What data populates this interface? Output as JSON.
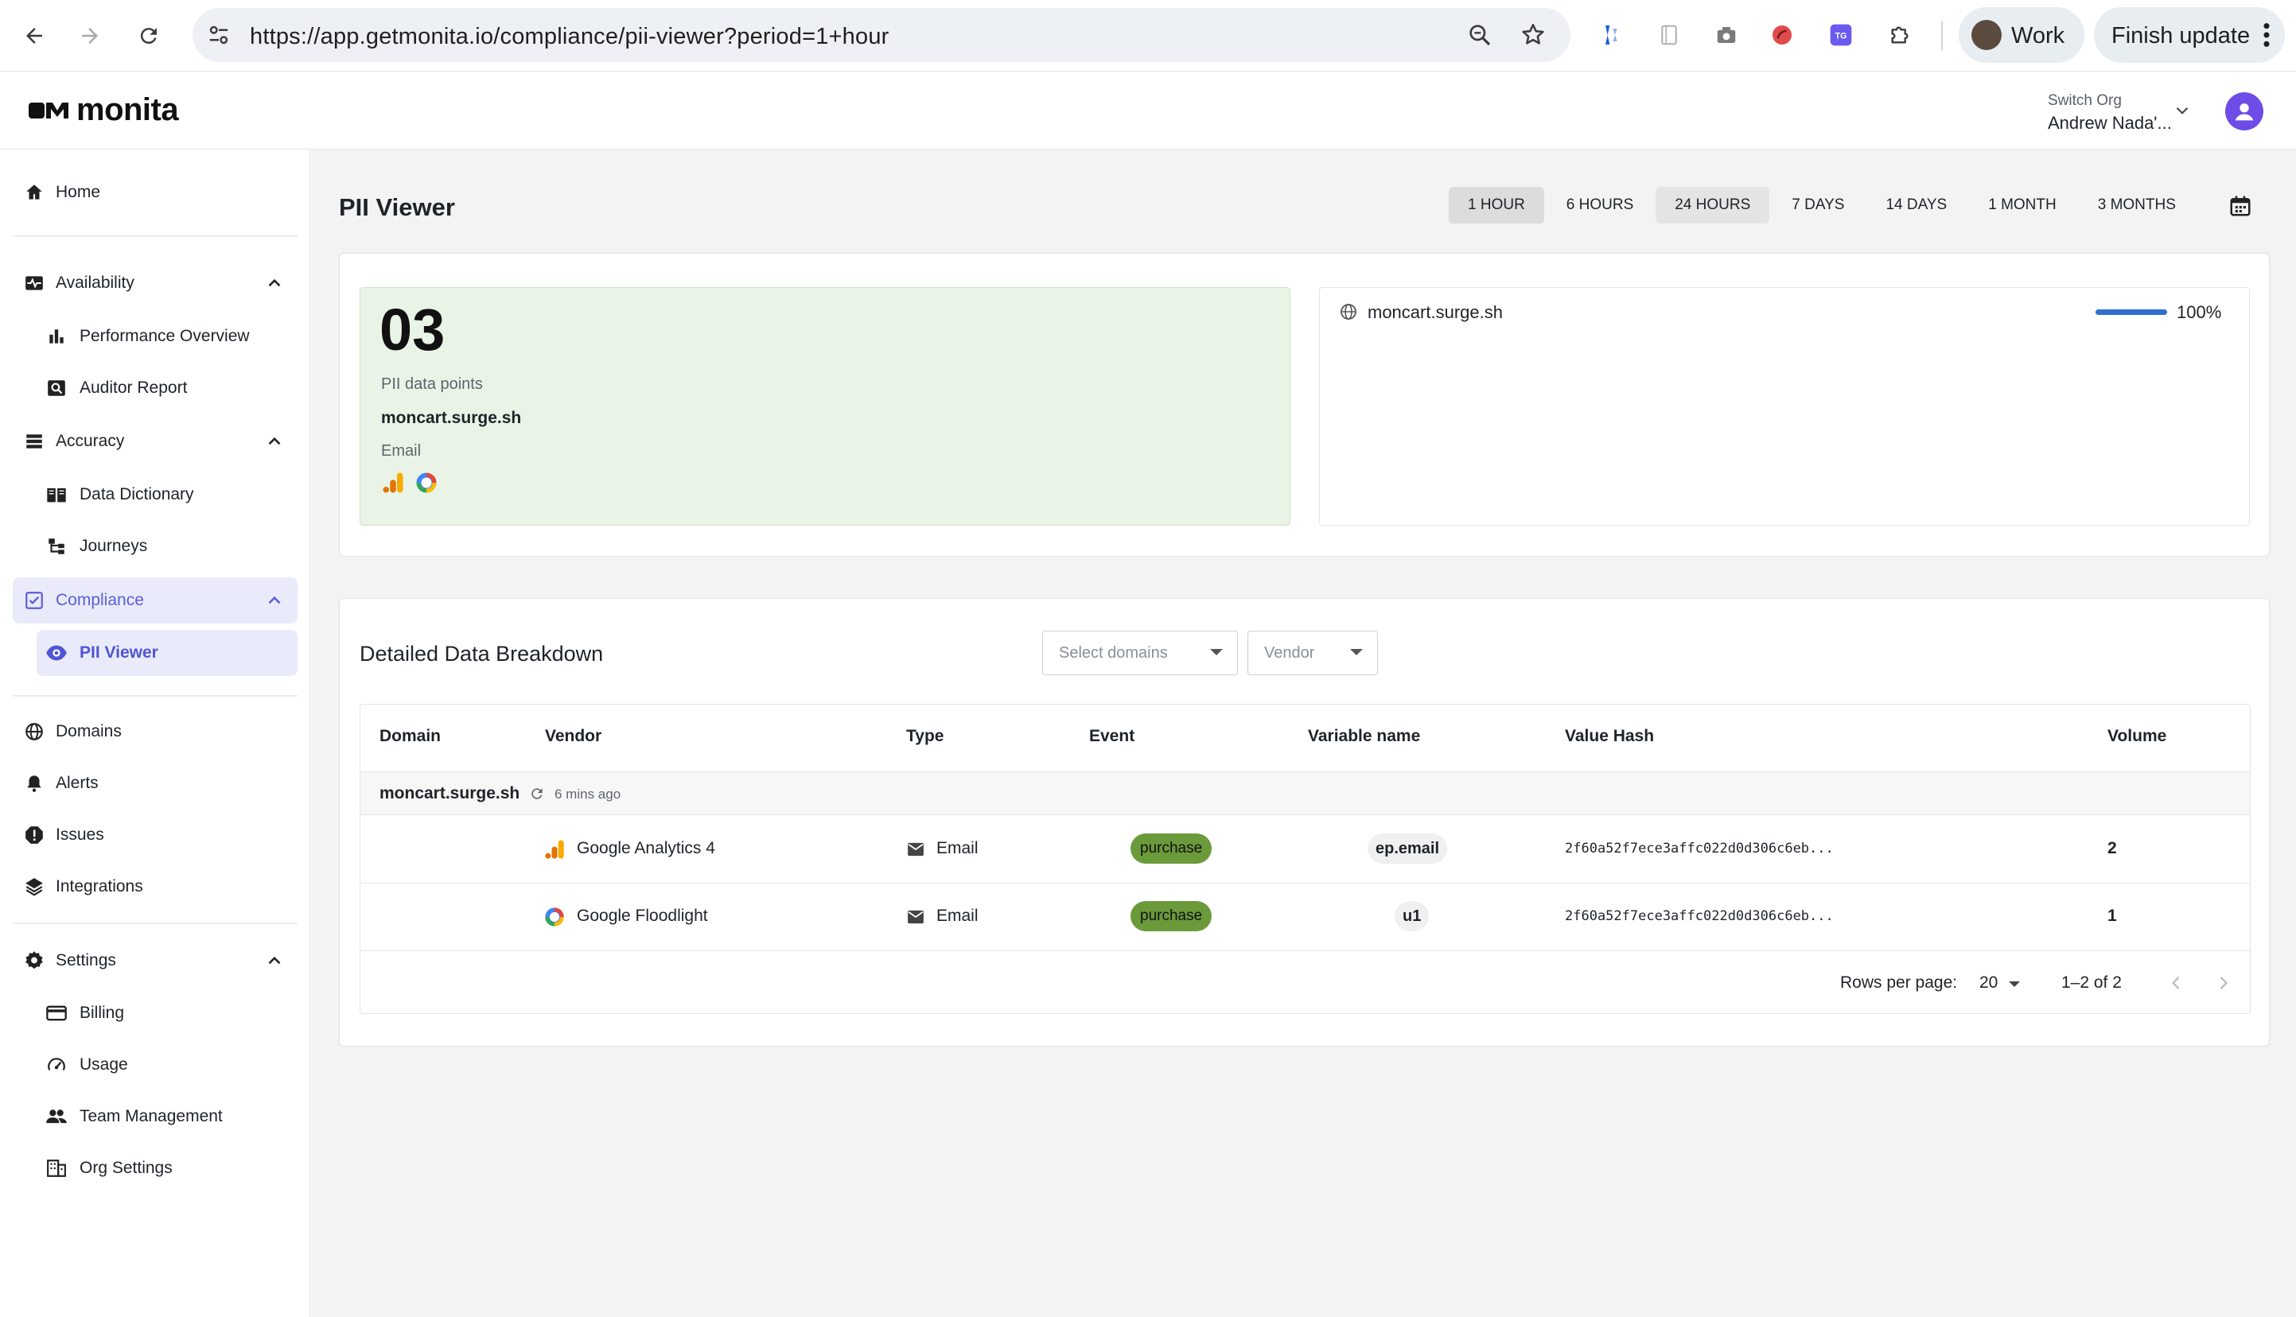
{
  "browser": {
    "url": "https://app.getmonita.io/compliance/pii-viewer?period=1+hour",
    "profile_label": "Work",
    "update_label": "Finish update",
    "extensions": [
      "tag-assistant-icon",
      "notes-icon",
      "camera-icon",
      "extension-red-icon",
      "tg-icon",
      "puzzle-icon"
    ],
    "ext_tg_text": "TG"
  },
  "header": {
    "logo_text": "monita",
    "org_label": "Switch Org",
    "org_name": "Andrew Nada'..."
  },
  "sidebar": {
    "home": "Home",
    "availability": "Availability",
    "performance_overview": "Performance Overview",
    "auditor_report": "Auditor Report",
    "accuracy": "Accuracy",
    "data_dictionary": "Data Dictionary",
    "journeys": "Journeys",
    "compliance": "Compliance",
    "pii_viewer": "PII Viewer",
    "domains": "Domains",
    "alerts": "Alerts",
    "issues": "Issues",
    "integrations": "Integrations",
    "settings": "Settings",
    "billing": "Billing",
    "usage": "Usage",
    "team_management": "Team Management",
    "org_settings": "Org Settings"
  },
  "page": {
    "title": "PII Viewer",
    "periods": [
      "1 HOUR",
      "6 HOURS",
      "24 HOURS",
      "7 DAYS",
      "14 DAYS",
      "1 MONTH",
      "3 MONTHS"
    ],
    "selected_period": "1 HOUR"
  },
  "summary": {
    "count": "03",
    "count_label": "PII data points",
    "domain": "moncart.surge.sh",
    "type": "Email",
    "vendor_icons": [
      "google-analytics-icon",
      "google-floodlight-icon"
    ],
    "domain_share": {
      "name": "moncart.surge.sh",
      "percent_label": "100%",
      "fraction": 1.0
    }
  },
  "detail": {
    "title": "Detailed Data Breakdown",
    "domain_select_placeholder": "Select domains",
    "vendor_select_placeholder": "Vendor",
    "columns": [
      "Domain",
      "Vendor",
      "Type",
      "Event",
      "Variable name",
      "Value Hash",
      "Volume"
    ],
    "group": {
      "domain": "moncart.surge.sh",
      "updated": "6 mins ago"
    },
    "rows": [
      {
        "vendor": "Google Analytics 4",
        "type": "Email",
        "event": "purchase",
        "variable": "ep.email",
        "hash": "2f60a52f7ece3affc022d0d306c6eb...",
        "volume": "2"
      },
      {
        "vendor": "Google Floodlight",
        "type": "Email",
        "event": "purchase",
        "variable": "u1",
        "hash": "2f60a52f7ece3affc022d0d306c6eb...",
        "volume": "1"
      }
    ],
    "pagination": {
      "rows_label": "Rows per page:",
      "rows_value": "20",
      "range": "1–2 of 2"
    }
  },
  "colors": {
    "accent": "#5b5fd6",
    "pii_card_bg": "#e9f4e7",
    "event_badge": "#6b9a3a",
    "domain_bar": "#2f6fd0"
  }
}
